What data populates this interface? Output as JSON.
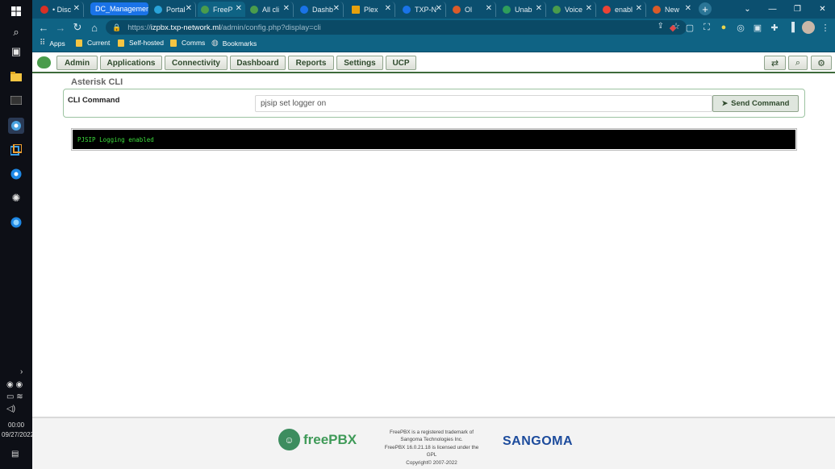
{
  "taskbar": {
    "time": "00:00",
    "date": "09/27/2022",
    "icons": [
      "windows-logo-icon",
      "search-icon",
      "task-view-icon",
      "file-explorer-icon",
      "terminal-icon",
      "chrome-icon",
      "vmware-icon",
      "edge-icon",
      "settings-icon",
      "browser-icon"
    ]
  },
  "tabs": [
    {
      "label": "• Disc",
      "color": "#d93025"
    },
    {
      "label": "DC_Management",
      "group": true
    },
    {
      "label": "Portal",
      "color": "#29a3d9"
    },
    {
      "label": "FreeP",
      "color": "#4a9c4c",
      "active": true
    },
    {
      "label": "All cli",
      "color": "#4a9c4c"
    },
    {
      "label": "Dashb",
      "color": "#1a73e8"
    },
    {
      "label": "Plex",
      "color": "#e5a00d"
    },
    {
      "label": "TXP-N",
      "color": "#1a73e8"
    },
    {
      "label": "Ol",
      "color": "#d95b2a"
    },
    {
      "label": "Unab",
      "color": "#2e9e5b"
    },
    {
      "label": "Voice",
      "color": "#4a9c4c"
    },
    {
      "label": "enabl",
      "color": "#ea4335"
    },
    {
      "label": "New",
      "color": "#d95b2a"
    }
  ],
  "address_bar": {
    "scheme": "https://",
    "host": "izpbx.txp-network.ml",
    "path": "/admin/config.php?display=cli"
  },
  "bookmarks": [
    {
      "label": "Apps",
      "icon": "apps-grid-icon"
    },
    {
      "label": "Current",
      "icon": "folder-icon"
    },
    {
      "label": "Self-hosted",
      "icon": "folder-icon"
    },
    {
      "label": "Comms",
      "icon": "folder-icon"
    },
    {
      "label": "Bookmarks",
      "icon": "globe-icon"
    }
  ],
  "freepbx_menu": [
    "Admin",
    "Applications",
    "Connectivity",
    "Dashboard",
    "Reports",
    "Settings",
    "UCP"
  ],
  "page": {
    "title": "Asterisk CLI",
    "cli_label": "CLI Command",
    "cli_value": "pjsip set logger on",
    "send_button": "Send Command",
    "output": "PJSIP Logging enabled"
  },
  "footer": {
    "brand": "freePBX",
    "line1": "FreePBX is a registered trademark of",
    "line2": "Sangoma Technologies Inc.",
    "line3": "FreePBX 16.0.21.18 is licensed under the GPL",
    "line4": "Copyright© 2007-2022",
    "vendor": "SANGOMA"
  }
}
